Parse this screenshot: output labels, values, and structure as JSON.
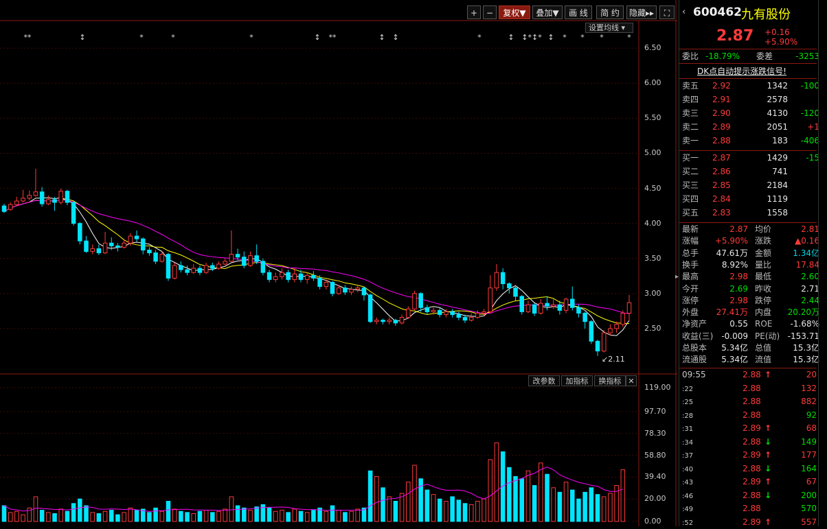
{
  "toolbar": {
    "plus": "+",
    "minus": "−",
    "fuquan": "复权",
    "diejia": "叠加",
    "huaxian": "画 线",
    "jianyue": "简 约",
    "yincang": "隐藏",
    "ma_setting": "设置均线"
  },
  "price_axis": [
    "6.50",
    "6.00",
    "5.50",
    "5.00",
    "4.50",
    "4.00",
    "3.50",
    "3.00",
    "2.50"
  ],
  "low_marker": "2.11",
  "volume_axis": [
    "119.00",
    "97.70",
    "78.30",
    "58.80",
    "39.40",
    "20.00",
    "0.00"
  ],
  "volume_buttons": {
    "gaicanshu": "改参数",
    "jiazhibiao": "加指标",
    "huanzhibiao": "换指标",
    "close": "✕"
  },
  "colors": {
    "up": "#ff3b3b",
    "down": "#00e5ff",
    "ma5": "#ffffff",
    "ma10": "#ffff00",
    "ma20": "#ff00ff",
    "brand": "#ffff00"
  },
  "chart_data": {
    "type": "candlestick",
    "ylim": [
      2.0,
      6.6
    ],
    "vol_ylim": [
      0,
      119
    ],
    "candles": [
      [
        4.25,
        4.17,
        4.28,
        4.15
      ],
      [
        4.2,
        4.27,
        4.3,
        4.18
      ],
      [
        4.27,
        4.32,
        4.38,
        4.25
      ],
      [
        4.32,
        4.36,
        4.48,
        4.3
      ],
      [
        4.36,
        4.4,
        4.47,
        4.33
      ],
      [
        4.4,
        4.45,
        4.78,
        4.38
      ],
      [
        4.45,
        4.28,
        4.52,
        4.24
      ],
      [
        4.28,
        4.34,
        4.4,
        4.26
      ],
      [
        4.34,
        4.3,
        4.38,
        4.18
      ],
      [
        4.3,
        4.46,
        4.5,
        4.27
      ],
      [
        4.46,
        4.3,
        4.48,
        4.26
      ],
      [
        4.3,
        4.0,
        4.32,
        3.97
      ],
      [
        4.0,
        3.75,
        4.02,
        3.7
      ],
      [
        3.75,
        3.6,
        3.82,
        3.58
      ],
      [
        3.6,
        3.64,
        3.7,
        3.56
      ],
      [
        3.64,
        3.58,
        3.7,
        3.55
      ],
      [
        3.58,
        3.72,
        3.88,
        3.56
      ],
      [
        3.72,
        3.68,
        3.8,
        3.62
      ],
      [
        3.68,
        3.66,
        3.72,
        3.6
      ],
      [
        3.66,
        3.72,
        3.78,
        3.64
      ],
      [
        3.72,
        3.82,
        3.86,
        3.68
      ],
      [
        3.82,
        3.78,
        3.9,
        3.74
      ],
      [
        3.78,
        3.62,
        3.8,
        3.56
      ],
      [
        3.62,
        3.58,
        3.66,
        3.54
      ],
      [
        3.58,
        3.46,
        3.62,
        3.42
      ],
      [
        3.46,
        3.56,
        3.6,
        3.44
      ],
      [
        3.56,
        3.22,
        3.58,
        3.18
      ],
      [
        3.22,
        3.4,
        3.44,
        3.2
      ],
      [
        3.4,
        3.34,
        3.46,
        3.3
      ],
      [
        3.34,
        3.3,
        3.4,
        3.26
      ],
      [
        3.3,
        3.36,
        3.42,
        3.28
      ],
      [
        3.36,
        3.3,
        3.4,
        3.26
      ],
      [
        3.3,
        3.4,
        3.44,
        3.28
      ],
      [
        3.4,
        3.36,
        3.44,
        3.32
      ],
      [
        3.36,
        3.42,
        3.46,
        3.34
      ],
      [
        3.42,
        3.46,
        3.5,
        3.4
      ],
      [
        3.46,
        3.56,
        3.9,
        3.44
      ],
      [
        3.56,
        3.52,
        3.64,
        3.48
      ],
      [
        3.52,
        3.4,
        3.6,
        3.36
      ],
      [
        3.4,
        3.54,
        3.6,
        3.38
      ],
      [
        3.54,
        3.46,
        3.7,
        3.42
      ],
      [
        3.46,
        3.3,
        3.5,
        3.26
      ],
      [
        3.3,
        3.2,
        3.34,
        3.16
      ],
      [
        3.2,
        3.24,
        3.3,
        3.16
      ],
      [
        3.24,
        3.3,
        3.36,
        3.2
      ],
      [
        3.3,
        3.2,
        3.34,
        3.16
      ],
      [
        3.2,
        3.28,
        3.36,
        3.16
      ],
      [
        3.28,
        3.2,
        3.34,
        3.16
      ],
      [
        3.2,
        3.26,
        3.3,
        3.14
      ],
      [
        3.26,
        3.22,
        3.32,
        3.18
      ],
      [
        3.22,
        3.1,
        3.26,
        3.06
      ],
      [
        3.1,
        3.16,
        3.2,
        3.06
      ],
      [
        3.16,
        3.0,
        3.18,
        2.96
      ],
      [
        3.0,
        3.08,
        3.12,
        2.98
      ],
      [
        3.08,
        3.02,
        3.12,
        2.98
      ],
      [
        3.02,
        3.06,
        3.1,
        2.98
      ],
      [
        3.06,
        3.08,
        3.12,
        3.02
      ],
      [
        3.08,
        2.98,
        3.1,
        2.9
      ],
      [
        2.98,
        2.6,
        3.0,
        2.58
      ],
      [
        2.6,
        2.62,
        2.66,
        2.56
      ],
      [
        2.62,
        2.6,
        2.64,
        2.56
      ],
      [
        2.6,
        2.62,
        2.66,
        2.56
      ],
      [
        2.62,
        2.58,
        2.64,
        2.54
      ],
      [
        2.58,
        2.66,
        2.7,
        2.56
      ],
      [
        2.66,
        2.78,
        2.82,
        2.64
      ],
      [
        2.78,
        3.0,
        3.04,
        2.76
      ],
      [
        3.0,
        2.8,
        3.02,
        2.74
      ],
      [
        2.8,
        2.74,
        2.84,
        2.7
      ],
      [
        2.74,
        2.76,
        2.82,
        2.7
      ],
      [
        2.76,
        2.7,
        2.8,
        2.66
      ],
      [
        2.7,
        2.74,
        2.78,
        2.66
      ],
      [
        2.74,
        2.7,
        2.78,
        2.66
      ],
      [
        2.7,
        2.66,
        2.74,
        2.62
      ],
      [
        2.66,
        2.62,
        2.7,
        2.58
      ],
      [
        2.62,
        2.66,
        2.72,
        2.6
      ],
      [
        2.66,
        2.72,
        2.76,
        2.64
      ],
      [
        2.72,
        2.74,
        2.78,
        2.68
      ],
      [
        2.74,
        3.08,
        3.26,
        2.72
      ],
      [
        3.08,
        3.3,
        3.42,
        3.04
      ],
      [
        3.3,
        3.14,
        3.36,
        3.06
      ],
      [
        3.14,
        3.08,
        3.16,
        3.0
      ],
      [
        3.08,
        2.96,
        3.1,
        2.9
      ],
      [
        2.96,
        2.74,
        2.98,
        2.7
      ],
      [
        2.74,
        2.84,
        2.9,
        2.72
      ],
      [
        2.84,
        2.72,
        2.86,
        2.68
      ],
      [
        2.72,
        2.86,
        2.92,
        2.7
      ],
      [
        2.86,
        2.82,
        2.96,
        2.76
      ],
      [
        2.82,
        2.84,
        2.92,
        2.78
      ],
      [
        2.84,
        2.76,
        2.9,
        2.7
      ],
      [
        2.76,
        2.92,
        2.94,
        2.72
      ],
      [
        2.92,
        2.8,
        3.1,
        2.76
      ],
      [
        2.8,
        2.72,
        2.84,
        2.66
      ],
      [
        2.72,
        2.6,
        2.74,
        2.5
      ],
      [
        2.6,
        2.32,
        2.62,
        2.28
      ],
      [
        2.32,
        2.18,
        2.34,
        2.11
      ],
      [
        2.18,
        2.44,
        2.48,
        2.16
      ],
      [
        2.44,
        2.5,
        2.56,
        2.4
      ],
      [
        2.5,
        2.56,
        2.6,
        2.44
      ],
      [
        2.56,
        2.72,
        2.76,
        2.52
      ],
      [
        2.72,
        2.87,
        2.98,
        2.6
      ]
    ],
    "volumes": [
      14,
      8,
      9,
      6,
      12,
      22,
      10,
      8,
      7,
      11,
      9,
      16,
      20,
      14,
      8,
      7,
      9,
      10,
      6,
      8,
      12,
      10,
      11,
      8,
      12,
      9,
      18,
      11,
      9,
      8,
      7,
      9,
      10,
      8,
      9,
      11,
      22,
      14,
      12,
      10,
      13,
      15,
      12,
      9,
      10,
      8,
      11,
      9,
      8,
      10,
      12,
      9,
      14,
      10,
      8,
      9,
      11,
      12,
      45,
      40,
      30,
      22,
      18,
      25,
      35,
      50,
      38,
      28,
      24,
      20,
      18,
      22,
      19,
      16,
      15,
      18,
      20,
      55,
      70,
      62,
      48,
      40,
      38,
      45,
      32,
      52,
      42,
      30,
      26,
      35,
      28,
      20,
      26,
      30,
      24,
      22,
      25,
      32,
      46
    ]
  },
  "quote": {
    "code": "600462",
    "name": "九有股份",
    "price": "2.87",
    "change": "+0.16",
    "change_pct": "+5.90%",
    "weibi_label": "委比",
    "weibi": "-18.79%",
    "weicha_label": "委差",
    "weicha": "-3253",
    "dk_signal": "DK点自动提示涨跌信号!",
    "asks": [
      {
        "label": "卖五",
        "price": "2.92",
        "vol": "1342",
        "delta": "-100"
      },
      {
        "label": "卖四",
        "price": "2.91",
        "vol": "2578",
        "delta": ""
      },
      {
        "label": "卖三",
        "price": "2.90",
        "vol": "4130",
        "delta": "-120"
      },
      {
        "label": "卖二",
        "price": "2.89",
        "vol": "2051",
        "delta": "+1"
      },
      {
        "label": "卖一",
        "price": "2.88",
        "vol": "183",
        "delta": "-406"
      }
    ],
    "bids": [
      {
        "label": "买一",
        "price": "2.87",
        "vol": "1429",
        "delta": "-15"
      },
      {
        "label": "买二",
        "price": "2.86",
        "vol": "741",
        "delta": ""
      },
      {
        "label": "买三",
        "price": "2.85",
        "vol": "2184",
        "delta": ""
      },
      {
        "label": "买四",
        "price": "2.84",
        "vol": "1119",
        "delta": ""
      },
      {
        "label": "买五",
        "price": "2.83",
        "vol": "1558",
        "delta": ""
      }
    ],
    "stats": [
      {
        "l1": "最新",
        "v1": "2.87",
        "c1": "red",
        "l2": "均价",
        "v2": "2.81",
        "c2": "red"
      },
      {
        "l1": "涨幅",
        "v1": "+5.90%",
        "c1": "red",
        "l2": "涨跌",
        "v2": "▲0.16",
        "c2": "red"
      },
      {
        "l1": "总手",
        "v1": "47.61万",
        "c1": "white",
        "l2": "金额",
        "v2": "1.34亿",
        "c2": "cyan"
      },
      {
        "l1": "换手",
        "v1": "8.92%",
        "c1": "white",
        "l2": "量比",
        "v2": "17.84",
        "c2": "red"
      },
      {
        "l1": "最高",
        "v1": "2.98",
        "c1": "red",
        "l2": "最低",
        "v2": "2.60",
        "c2": "green"
      },
      {
        "l1": "今开",
        "v1": "2.69",
        "c1": "green",
        "l2": "昨收",
        "v2": "2.71",
        "c2": "white"
      },
      {
        "l1": "涨停",
        "v1": "2.98",
        "c1": "red",
        "l2": "跌停",
        "v2": "2.44",
        "c2": "green"
      },
      {
        "l1": "外盘",
        "v1": "27.41万",
        "c1": "red",
        "l2": "内盘",
        "v2": "20.20万",
        "c2": "green"
      },
      {
        "l1": "净资产",
        "v1": "0.55",
        "c1": "white",
        "l2": "ROE",
        "v2": "-1.68%",
        "c2": "white"
      },
      {
        "l1": "收益(三)",
        "v1": "-0.009",
        "c1": "white",
        "l2": "PE(动)",
        "v2": "-153.71",
        "c2": "white"
      },
      {
        "l1": "总股本",
        "v1": "5.34亿",
        "c1": "white",
        "l2": "总值",
        "v2": "15.3亿",
        "c2": "white"
      },
      {
        "l1": "流通股",
        "v1": "5.34亿",
        "c1": "white",
        "l2": "流值",
        "v2": "15.3亿",
        "c2": "white"
      }
    ],
    "ticks": [
      {
        "time": "09:55",
        "price": "2.88",
        "dir": "↑",
        "dcolor": "red",
        "vol": "20",
        "vcolor": "red"
      },
      {
        "time": ":22",
        "price": "2.88",
        "dir": "",
        "dcolor": "red",
        "vol": "132",
        "vcolor": "red"
      },
      {
        "time": ":25",
        "price": "2.88",
        "dir": "",
        "dcolor": "red",
        "vol": "882",
        "vcolor": "red"
      },
      {
        "time": ":28",
        "price": "2.88",
        "dir": "",
        "dcolor": "red",
        "vol": "92",
        "vcolor": "green"
      },
      {
        "time": ":31",
        "price": "2.89",
        "dir": "↑",
        "dcolor": "red",
        "vol": "68",
        "vcolor": "red"
      },
      {
        "time": ":34",
        "price": "2.88",
        "dir": "↓",
        "dcolor": "green",
        "vol": "149",
        "vcolor": "green"
      },
      {
        "time": ":37",
        "price": "2.89",
        "dir": "↑",
        "dcolor": "red",
        "vol": "177",
        "vcolor": "red"
      },
      {
        "time": ":40",
        "price": "2.88",
        "dir": "↓",
        "dcolor": "green",
        "vol": "164",
        "vcolor": "green"
      },
      {
        "time": ":43",
        "price": "2.89",
        "dir": "↑",
        "dcolor": "red",
        "vol": "67",
        "vcolor": "red"
      },
      {
        "time": ":46",
        "price": "2.88",
        "dir": "↓",
        "dcolor": "green",
        "vol": "200",
        "vcolor": "green"
      },
      {
        "time": ":49",
        "price": "2.88",
        "dir": "",
        "dcolor": "red",
        "vol": "570",
        "vcolor": "green"
      },
      {
        "time": ":52",
        "price": "2.89",
        "dir": "↑",
        "dcolor": "red",
        "vol": "557",
        "vcolor": "red"
      }
    ]
  }
}
